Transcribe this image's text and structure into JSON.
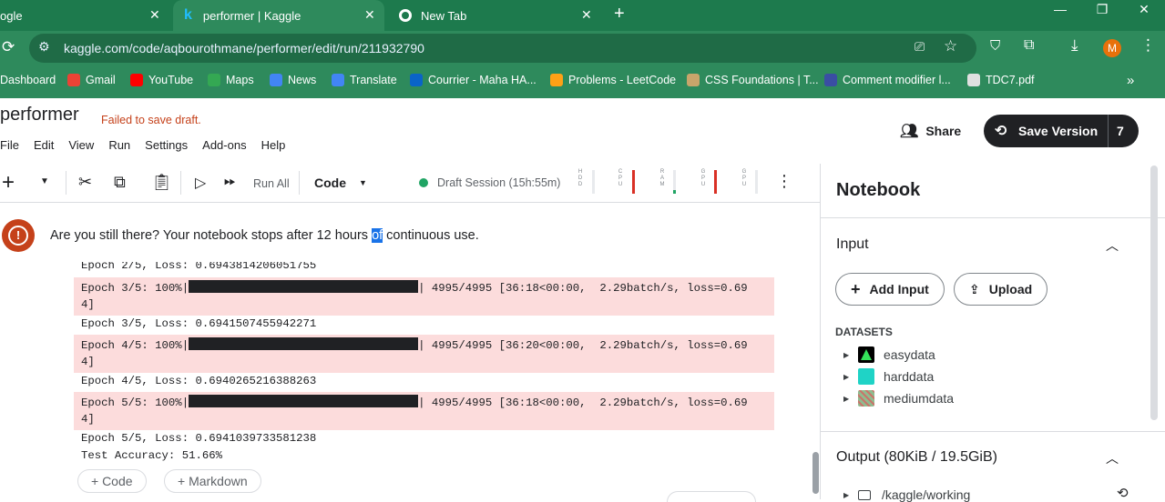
{
  "browser": {
    "tabs": [
      {
        "title": "ogle"
      },
      {
        "title": "performer | Kaggle"
      },
      {
        "title": "New Tab"
      }
    ],
    "url": "kaggle.com/code/aqbourothmane/performer/edit/run/211932790",
    "profile_initial": "M",
    "bookmarks": [
      {
        "label": "Dashboard"
      },
      {
        "label": "Gmail"
      },
      {
        "label": "YouTube"
      },
      {
        "label": "Maps"
      },
      {
        "label": "News"
      },
      {
        "label": "Translate"
      },
      {
        "label": "Courrier - Maha HA..."
      },
      {
        "label": "Problems - LeetCode"
      },
      {
        "label": "CSS Foundations | T..."
      },
      {
        "label": "Comment modifier l..."
      },
      {
        "label": "TDC7.pdf"
      }
    ]
  },
  "notebook": {
    "title": "performer",
    "save_status": "Failed to save draft.",
    "menu": [
      "File",
      "Edit",
      "View",
      "Run",
      "Settings",
      "Add-ons",
      "Help"
    ],
    "share_label": "Share",
    "save_version_label": "Save Version",
    "save_version_count": "7"
  },
  "toolbar": {
    "run_all_label": "Run All",
    "cell_type": "Code",
    "session": "Draft Session (15h:55m)",
    "meters": [
      {
        "label": "HDD",
        "level": 0.0
      },
      {
        "label": "CPU",
        "level": 1.0
      },
      {
        "label": "RAM",
        "level": 0.15
      },
      {
        "label": "GPU",
        "level": 1.0
      },
      {
        "label": "GPU",
        "level": 0.0
      }
    ]
  },
  "alert": {
    "before": "Are you still there? Your notebook stops after 12 hours ",
    "highlight": "of",
    "after": " continuous use."
  },
  "output": {
    "partial_line": "Epoch 2/5, Loss: 0.6943814206051755",
    "blocks": [
      {
        "bar_start": "Epoch 3/5: 100%|",
        "bar_end": "| 4995/4995 [36:18<00:00,  2.29batch/s, loss=0.69",
        "wrap": "4]",
        "loss_line": "Epoch 3/5, Loss: 0.6941507455942271"
      },
      {
        "bar_start": "Epoch 4/5: 100%|",
        "bar_end": "| 4995/4995 [36:20<00:00,  2.29batch/s, loss=0.69",
        "wrap": "4]",
        "loss_line": "Epoch 4/5, Loss: 0.6940265216388263"
      },
      {
        "bar_start": "Epoch 5/5: 100%|",
        "bar_end": "| 4995/4995 [36:18<00:00,  2.29batch/s, loss=0.69",
        "wrap": "4]",
        "loss_line": "Epoch 5/5, Loss: 0.6941039733581238"
      }
    ],
    "test_accuracy": "Test Accuracy: 51.66%",
    "add_code_label": "+ Code",
    "add_markdown_label": "+ Markdown"
  },
  "panel": {
    "title": "Notebook",
    "input_label": "Input",
    "add_input_label": "Add Input",
    "upload_label": "Upload",
    "datasets_heading": "DATASETS",
    "datasets": [
      {
        "name": "easydata",
        "color": "#20beff"
      },
      {
        "name": "harddata",
        "color": "#1fd3c6"
      },
      {
        "name": "mediumdata",
        "color": "#8fbc8f"
      }
    ],
    "output_label": "Output (80KiB / 19.5GiB)",
    "output_path": "/kaggle/working"
  },
  "colors": {
    "chrome_green": "#1d7a4d",
    "accent_error": "#c5411a",
    "progress_bg": "#fcdcdc"
  }
}
